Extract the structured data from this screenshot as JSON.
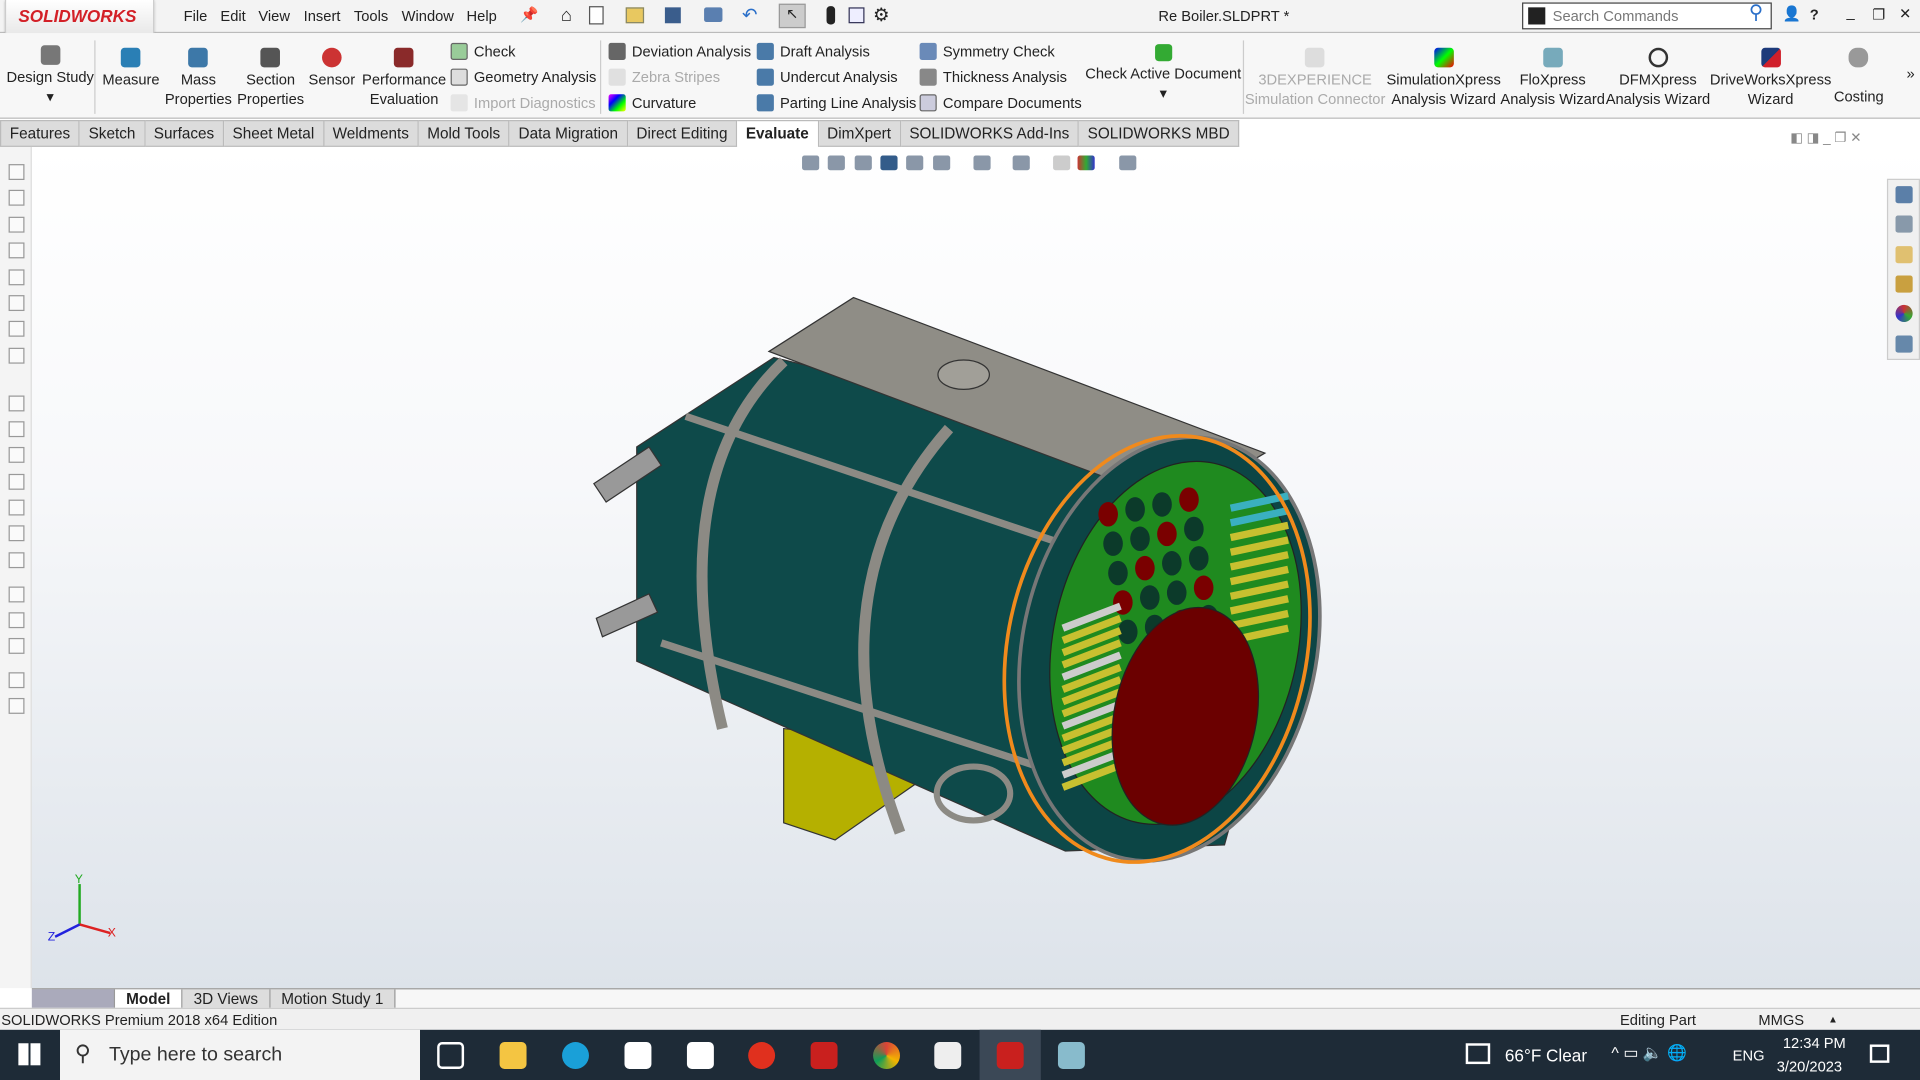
{
  "app": {
    "logo": "SOLIDWORKS",
    "title": "Re Boiler.SLDPRT *",
    "search_placeholder": "Search Commands"
  },
  "menu": [
    "File",
    "Edit",
    "View",
    "Insert",
    "Tools",
    "Window",
    "Help"
  ],
  "ribbon": {
    "design_study": "Design Study",
    "big": [
      {
        "l1": "Measure",
        "l2": ""
      },
      {
        "l1": "Mass",
        "l2": "Properties"
      },
      {
        "l1": "Section",
        "l2": "Properties"
      },
      {
        "l1": "Sensor",
        "l2": ""
      },
      {
        "l1": "Performance",
        "l2": "Evaluation"
      }
    ],
    "col1": [
      {
        "label": "Check",
        "disabled": false
      },
      {
        "label": "Geometry Analysis",
        "disabled": false
      },
      {
        "label": "Import Diagnostics",
        "disabled": true
      }
    ],
    "col2": [
      {
        "label": "Deviation Analysis",
        "disabled": false
      },
      {
        "label": "Zebra Stripes",
        "disabled": true
      },
      {
        "label": "Curvature",
        "disabled": false
      }
    ],
    "col3": [
      {
        "label": "Draft Analysis",
        "disabled": false
      },
      {
        "label": "Undercut Analysis",
        "disabled": false
      },
      {
        "label": "Parting Line Analysis",
        "disabled": false
      }
    ],
    "col4": [
      {
        "label": "Symmetry Check",
        "disabled": false
      },
      {
        "label": "Thickness Analysis",
        "disabled": false
      },
      {
        "label": "Compare Documents",
        "disabled": false
      }
    ],
    "check_active": "Check Active Document",
    "addins": [
      {
        "l1": "3DEXPERIENCE",
        "l2": "Simulation Connector",
        "disabled": true
      },
      {
        "l1": "SimulationXpress",
        "l2": "Analysis Wizard"
      },
      {
        "l1": "FloXpress",
        "l2": "Analysis Wizard"
      },
      {
        "l1": "DFMXpress",
        "l2": "Analysis Wizard"
      },
      {
        "l1": "DriveWorksXpress",
        "l2": "Wizard"
      },
      {
        "l1": "Costing",
        "l2": ""
      }
    ],
    "more": "»"
  },
  "tabs": [
    "Features",
    "Sketch",
    "Surfaces",
    "Sheet Metal",
    "Weldments",
    "Mold Tools",
    "Data Migration",
    "Direct Editing",
    "Evaluate",
    "DimXpert",
    "SOLIDWORKS Add-Ins",
    "SOLIDWORKS MBD"
  ],
  "active_tab": "Evaluate",
  "triad": {
    "x": "X",
    "y": "Y",
    "z": "Z"
  },
  "bottom_tabs": [
    "Model",
    "3D Views",
    "Motion Study 1"
  ],
  "status": {
    "edition": "SOLIDWORKS Premium 2018 x64 Edition",
    "mode": "Editing Part",
    "units": "MMGS"
  },
  "taskbar": {
    "search": "Type here to search",
    "weather": "66°F  Clear",
    "lang": "ENG",
    "time": "12:34 PM",
    "date": "3/20/2023"
  },
  "colors": {
    "body": "#0e4a4a",
    "selection": "#f08a1c",
    "plate": "#1f8a1f",
    "fire": "#6b0000",
    "stand": "#b5b000"
  }
}
